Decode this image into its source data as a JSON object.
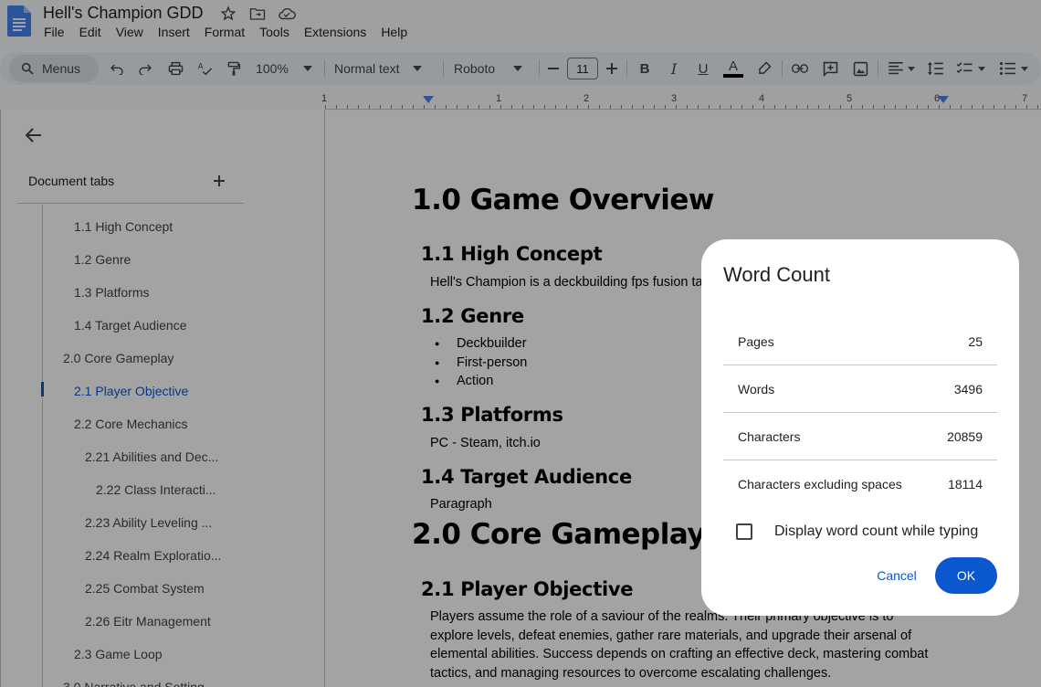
{
  "window": {
    "doc_title": "Hell's Champion GDD"
  },
  "menubar": {
    "items": [
      "File",
      "Edit",
      "View",
      "Insert",
      "Format",
      "Tools",
      "Extensions",
      "Help"
    ]
  },
  "toolbar": {
    "search_label": "Menus",
    "zoom": "100%",
    "style": "Normal text",
    "font": "Roboto",
    "font_size": "11",
    "bold": "B",
    "italic": "I",
    "underline": "U",
    "text_color": "A"
  },
  "ruler": {
    "numbers": [
      "1",
      "1",
      "2",
      "3",
      "4",
      "5",
      "6",
      "7"
    ]
  },
  "sidebar": {
    "header": "Document tabs",
    "items": [
      {
        "label": "1.1 High Concept"
      },
      {
        "label": "1.2 Genre"
      },
      {
        "label": "1.3 Platforms"
      },
      {
        "label": "1.4 Target Audience"
      },
      {
        "label": "2.0 Core Gameplay"
      },
      {
        "label": "2.1 Player Objective"
      },
      {
        "label": "2.2 Core Mechanics"
      },
      {
        "label": "2.21 Abilities and Dec..."
      },
      {
        "label": "2.22 Class Interacti..."
      },
      {
        "label": "2.23 Ability Leveling ..."
      },
      {
        "label": "2.24 Realm Exploratio..."
      },
      {
        "label": "2.25 Combat System"
      },
      {
        "label": "2.26 Eitr Management"
      },
      {
        "label": "2.3 Game Loop"
      },
      {
        "label": "3.0 Narrative and Setting"
      }
    ]
  },
  "document": {
    "h1_overview": "1.0 Game Overview",
    "h2_high_concept": "1.1 High Concept",
    "p_high_concept": "Hell's Champion is a deckbuilding fps fusion ta",
    "h2_genre": "1.2 Genre",
    "genres": [
      "Deckbuilder",
      "First-person",
      "Action"
    ],
    "h2_platforms": "1.3 Platforms",
    "p_platforms": "PC - Steam, itch.io",
    "h2_audience": "1.4 Target Audience",
    "p_audience": "Paragraph",
    "h1_core": "2.0 Core Gameplay",
    "h2_objective": "2.1 Player Objective",
    "p_objective_lines": [
      "Players assume the role of a saviour of the realms. Their primary objective is to",
      "explore levels, defeat enemies, gather rare materials, and upgrade their arsenal of",
      "elemental abilities. Success depends on crafting an effective deck, mastering combat",
      "tactics, and managing resources to overcome escalating challenges."
    ]
  },
  "dialog": {
    "title": "Word Count",
    "stats": [
      {
        "label": "Pages",
        "value": "25"
      },
      {
        "label": "Words",
        "value": "3496"
      },
      {
        "label": "Characters",
        "value": "20859"
      },
      {
        "label": "Characters excluding spaces",
        "value": "18114"
      }
    ],
    "checkbox_label": "Display word count while typing",
    "checkbox_checked": false,
    "cancel_label": "Cancel",
    "ok_label": "OK"
  },
  "colors": {
    "accent": "#0b57d0",
    "docs_blue": "#4285f4"
  }
}
